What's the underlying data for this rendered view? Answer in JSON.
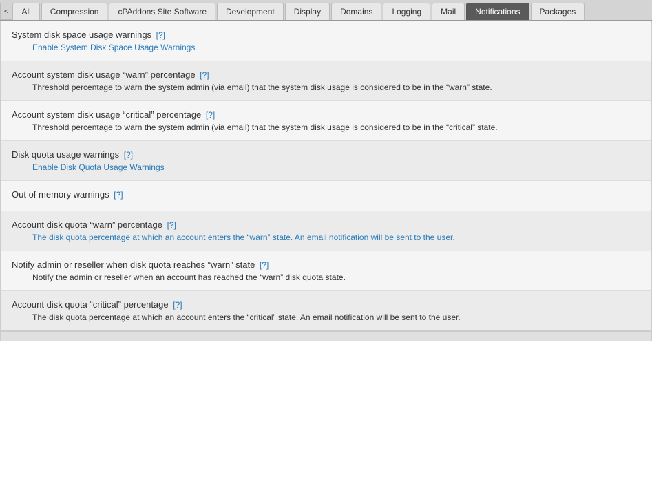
{
  "tabs": [
    {
      "label": "<",
      "id": "scroll-left"
    },
    {
      "label": "All",
      "id": "all",
      "active": false
    },
    {
      "label": "Compression",
      "id": "compression",
      "active": false
    },
    {
      "label": "cPAddons Site Software",
      "id": "cpaddons",
      "active": false
    },
    {
      "label": "Development",
      "id": "development",
      "active": false
    },
    {
      "label": "Display",
      "id": "display",
      "active": false
    },
    {
      "label": "Domains",
      "id": "domains",
      "active": false
    },
    {
      "label": "Logging",
      "id": "logging",
      "active": false
    },
    {
      "label": "Mail",
      "id": "mail",
      "active": false
    },
    {
      "label": "Notifications",
      "id": "notifications",
      "active": true
    },
    {
      "label": "Packages",
      "id": "packages",
      "active": false
    }
  ],
  "settings": [
    {
      "id": "system-disk-space-usage-warnings",
      "title": "System disk space usage warnings",
      "help_label": "[?]",
      "description": "Enable System Disk Space Usage Warnings",
      "desc_style": "blue"
    },
    {
      "id": "account-system-disk-warn-pct",
      "title": "Account system disk usage “warn” percentage",
      "help_label": "[?]",
      "description": "Threshold percentage to warn the system admin (via email) that the system disk usage is considered to be in the “warn” state.",
      "desc_style": "dark"
    },
    {
      "id": "account-system-disk-critical-pct",
      "title": "Account system disk usage “critical” percentage",
      "help_label": "[?]",
      "description": "Threshold percentage to warn the system admin (via email) that the system disk usage is considered to be in the “critical” state.",
      "desc_style": "dark"
    },
    {
      "id": "disk-quota-usage-warnings",
      "title": "Disk quota usage warnings",
      "help_label": "[?]",
      "description": "Enable Disk Quota Usage Warnings",
      "desc_style": "blue"
    },
    {
      "id": "out-of-memory-warnings",
      "title": "Out of memory warnings",
      "help_label": "[?]",
      "description": "",
      "desc_style": "dark"
    },
    {
      "id": "account-disk-quota-warn-pct",
      "title": "Account disk quota “warn” percentage",
      "help_label": "[?]",
      "description": "The disk quota percentage at which an account enters the “warn” state. An email notification will be sent to the user.",
      "desc_style": "blue"
    },
    {
      "id": "notify-admin-reseller-disk-quota-warn",
      "title": "Notify admin or reseller when disk quota reaches “warn” state",
      "help_label": "[?]",
      "description": "Notify the admin or reseller when an account has reached the “warn” disk quota state.",
      "desc_style": "dark"
    },
    {
      "id": "account-disk-quota-critical-pct",
      "title": "Account disk quota “critical” percentage",
      "help_label": "[?]",
      "description": "The disk quota percentage at which an account enters the “critical” state. An email notification will be sent to the user.",
      "desc_style": "dark"
    }
  ]
}
